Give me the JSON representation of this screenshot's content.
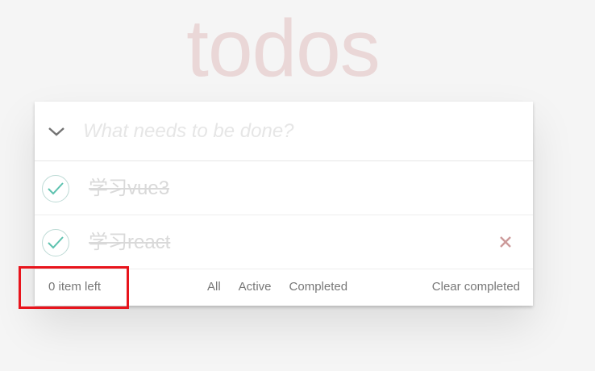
{
  "app": {
    "title": "todos"
  },
  "header": {
    "placeholder": "What needs to be done?"
  },
  "todos": [
    {
      "label": "学习vue3",
      "completed": true
    },
    {
      "label": "学习react",
      "completed": true
    }
  ],
  "footer": {
    "count_text": "0 item left",
    "filters": [
      "All",
      "Active",
      "Completed"
    ],
    "clear_label": "Clear completed"
  },
  "colors": {
    "title": "rgba(175,47,47,0.15)",
    "check": "#5dc2af",
    "destroy": "#cc9a9a",
    "highlight": "#e8141c"
  },
  "icons": {
    "toggle_all": "chevron-down-icon",
    "check": "checkmark-icon",
    "destroy": "close-icon"
  }
}
